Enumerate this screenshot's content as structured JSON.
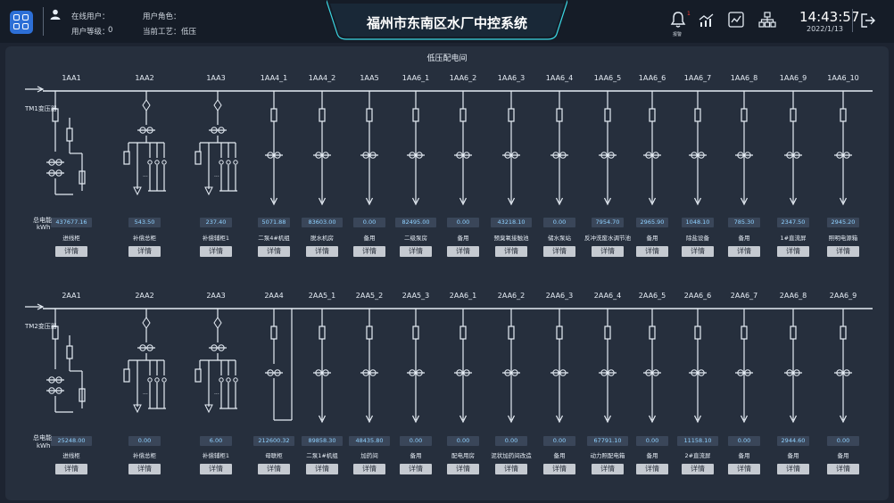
{
  "header": {
    "title": "福州市东南区水厂中控系统",
    "online_user_label": "在线用户：",
    "user_level_label": "用户等级：",
    "user_level_value": "0",
    "user_role_label": "用户角色：",
    "current_process_label": "当前工艺：",
    "current_process_value": "低压",
    "alarm_count": "1",
    "alarm_label": "报警",
    "time": "14:43:57",
    "date": "2022/1/13"
  },
  "panel": {
    "title": "低压配电间"
  },
  "labels": {
    "energy": "总电能",
    "unit": "kWh",
    "detail": "详情"
  },
  "row1": {
    "transformer": "TM1变压器",
    "cabinets": [
      {
        "id": "1AA1",
        "value": "437677.16",
        "name": "进线柜"
      },
      {
        "id": "1AA2",
        "value": "543.50",
        "name": "补偿总柜"
      },
      {
        "id": "1AA3",
        "value": "237.40",
        "name": "补偿辅柜1"
      },
      {
        "id": "1AA4_1",
        "value": "5071.88",
        "name": "二泵4#机组"
      },
      {
        "id": "1AA4_2",
        "value": "83603.00",
        "name": "脱水机房"
      },
      {
        "id": "1AA5",
        "value": "0.00",
        "name": "备用"
      },
      {
        "id": "1AA6_1",
        "value": "82495.00",
        "name": "二级泵房"
      },
      {
        "id": "1AA6_2",
        "value": "0.00",
        "name": "备用"
      },
      {
        "id": "1AA6_3",
        "value": "43218.10",
        "name": "预臭氧接触池"
      },
      {
        "id": "1AA6_4",
        "value": "0.00",
        "name": "储水泵站"
      },
      {
        "id": "1AA6_5",
        "value": "7954.70",
        "name": "反冲洗废水调节池"
      },
      {
        "id": "1AA6_6",
        "value": "2965.90",
        "name": "备用"
      },
      {
        "id": "1AA6_7",
        "value": "1048.10",
        "name": "除盐设备"
      },
      {
        "id": "1AA6_8",
        "value": "785.30",
        "name": "备用"
      },
      {
        "id": "1AA6_9",
        "value": "2347.50",
        "name": "1#直流屏"
      },
      {
        "id": "1AA6_10",
        "value": "2945.20",
        "name": "照明电源箱"
      }
    ]
  },
  "row2": {
    "transformer": "TM2变压器",
    "cabinets": [
      {
        "id": "2AA1",
        "value": "25248.00",
        "name": "进线柜"
      },
      {
        "id": "2AA2",
        "value": "0.00",
        "name": "补偿总柜"
      },
      {
        "id": "2AA3",
        "value": "6.00",
        "name": "补偿辅柜1"
      },
      {
        "id": "2AA4",
        "value": "212600.32",
        "name": "母联柜"
      },
      {
        "id": "2AA5_1",
        "value": "89858.30",
        "name": "二泵1#机组"
      },
      {
        "id": "2AA5_2",
        "value": "48435.80",
        "name": "加药间"
      },
      {
        "id": "2AA5_3",
        "value": "0.00",
        "name": "备用"
      },
      {
        "id": "2AA6_1",
        "value": "0.00",
        "name": "配电用房"
      },
      {
        "id": "2AA6_2",
        "value": "0.00",
        "name": "泥状加药间改造"
      },
      {
        "id": "2AA6_3",
        "value": "0.00",
        "name": "备用"
      },
      {
        "id": "2AA6_4",
        "value": "67791.10",
        "name": "动力照配电箱"
      },
      {
        "id": "2AA6_5",
        "value": "0.00",
        "name": "备用"
      },
      {
        "id": "2AA6_6",
        "value": "11158.10",
        "name": "2#直流屏"
      },
      {
        "id": "2AA6_7",
        "value": "0.00",
        "name": "备用"
      },
      {
        "id": "2AA6_8",
        "value": "2944.60",
        "name": "备用"
      },
      {
        "id": "2AA6_9",
        "value": "0.00",
        "name": "备用"
      }
    ]
  }
}
